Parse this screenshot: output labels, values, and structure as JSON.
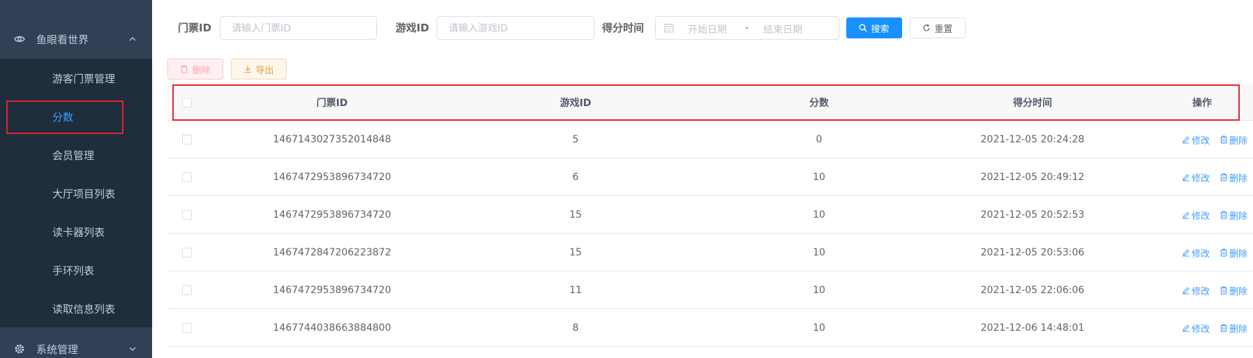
{
  "sidebar": {
    "group1": {
      "label": "鱼眼看世界",
      "icon": "eye-icon",
      "expanded": true
    },
    "items": [
      {
        "label": "游客门票管理",
        "active": false
      },
      {
        "label": "分数",
        "active": true
      },
      {
        "label": "会员管理",
        "active": false
      },
      {
        "label": "大厅项目列表",
        "active": false
      },
      {
        "label": "读卡器列表",
        "active": false
      },
      {
        "label": "手环列表",
        "active": false
      },
      {
        "label": "读取信息列表",
        "active": false
      }
    ],
    "group2": {
      "label": "系统管理",
      "icon": "gear-icon",
      "expanded": false
    }
  },
  "filters": {
    "ticket_label": "门票ID",
    "ticket_placeholder": "请输入门票ID",
    "game_label": "游戏ID",
    "game_placeholder": "请输入游戏ID",
    "time_label": "得分时间",
    "date_start_placeholder": "开始日期",
    "date_separator": "-",
    "date_end_placeholder": "结束日期",
    "search_label": "搜索",
    "reset_label": "重置"
  },
  "toolbar": {
    "delete_label": "删除",
    "export_label": "导出"
  },
  "table": {
    "columns": [
      "门票ID",
      "游戏ID",
      "分数",
      "得分时间",
      "操作"
    ],
    "edit_label": "修改",
    "delete_label": "删除",
    "rows": [
      {
        "ticket_id": "1467143027352014848",
        "game_id": "5",
        "score": "0",
        "time": "2021-12-05 20:24:28"
      },
      {
        "ticket_id": "1467472953896734720",
        "game_id": "6",
        "score": "10",
        "time": "2021-12-05 20:49:12"
      },
      {
        "ticket_id": "1467472953896734720",
        "game_id": "15",
        "score": "10",
        "time": "2021-12-05 20:52:53"
      },
      {
        "ticket_id": "1467472847206223872",
        "game_id": "15",
        "score": "10",
        "time": "2021-12-05 20:53:06"
      },
      {
        "ticket_id": "1467472953896734720",
        "game_id": "11",
        "score": "10",
        "time": "2021-12-05 22:06:06"
      },
      {
        "ticket_id": "1467744038663884800",
        "game_id": "8",
        "score": "10",
        "time": "2021-12-06 14:48:01"
      }
    ]
  },
  "colors": {
    "sidebar_bg": "#304156",
    "submenu_bg": "#1f2d3d",
    "accent": "#409eff",
    "primary_button": "#1890ff",
    "highlight": "#e0262e"
  }
}
